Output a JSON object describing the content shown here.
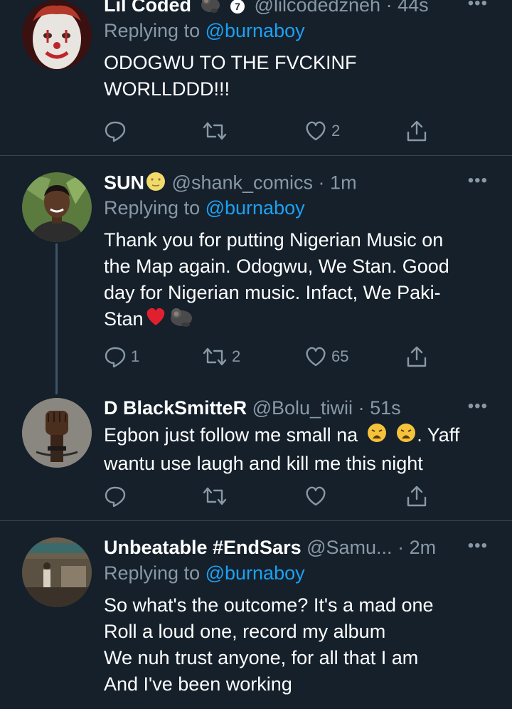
{
  "tweets": [
    {
      "name": "Lil Coded",
      "name_emoji": "gorilla",
      "badge": "7",
      "handle": "@lilcodedzneh",
      "dot": "·",
      "time": "44s",
      "reply_prefix": "Replying to",
      "reply_to": "@burnaboy",
      "body": [
        "ODOGWU TO THE FVCKINF",
        "WORLLDDD!!!"
      ],
      "reply_count": "",
      "retweet_count": "",
      "like_count": "2",
      "avatar": "clown-avatar"
    },
    {
      "name": "SUN",
      "name_emoji": "new-moon-face",
      "handle": "@shank_comics",
      "dot": "·",
      "time": "1m",
      "reply_prefix": "Replying to",
      "reply_to": "@burnaboy",
      "body": [
        "Thank you for putting Nigerian Music on",
        "the Map again. Odogwu, We Stan. Good",
        "day for Nigerian music. Infact, We Paki-",
        "Stan"
      ],
      "body_emojis": [
        "red-heart",
        "gorilla"
      ],
      "reply_count": "1",
      "retweet_count": "2",
      "like_count": "65",
      "avatar": "man-portrait-avatar"
    },
    {
      "name": "D BlackSmitteR",
      "handle": "@Bolu_tiwii",
      "dot": "·",
      "time": "51s",
      "body": [
        "Egbon just follow me small na",
        ". Yaff",
        "wantu use laugh and kill me this night"
      ],
      "body_emojis": [
        "weary-face",
        "weary-face"
      ],
      "reply_count": "",
      "retweet_count": "",
      "like_count": "",
      "avatar": "raised-fist-avatar"
    },
    {
      "name": "Unbeatable #EndSars",
      "handle": "@Samu...",
      "dot": "·",
      "time": "2m",
      "reply_prefix": "Replying to",
      "reply_to": "@burnaboy",
      "body": [
        "So what's the outcome? It's a mad one",
        "Roll a loud one, record my album",
        "We nuh trust anyone, for all that I am",
        "And I've been working"
      ],
      "reply_count": "",
      "retweet_count": "",
      "like_count": "",
      "avatar": "street-photo-avatar"
    }
  ],
  "more_label": "•••",
  "colors": {
    "background": "#15202b",
    "text": "#ffffff",
    "muted": "#8899a6",
    "link": "#1da1f2",
    "divider": "#38444d"
  }
}
